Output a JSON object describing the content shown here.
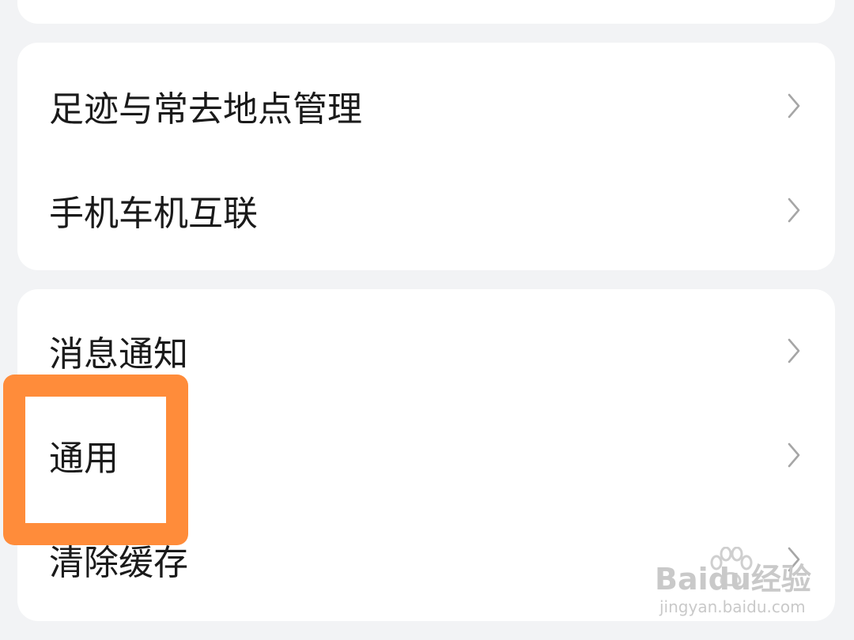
{
  "settings_groups": [
    {
      "items": [
        {
          "label": "足迹与常去地点管理"
        },
        {
          "label": "手机车机互联"
        }
      ]
    },
    {
      "items": [
        {
          "label": "消息通知"
        },
        {
          "label": "通用"
        },
        {
          "label": "清除缓存"
        }
      ]
    }
  ],
  "highlight": {
    "target": "通用",
    "color": "#ff8c3a"
  },
  "watermark": {
    "brand": "Baidu经验",
    "url": "jingyan.baidu.com"
  },
  "icons": {
    "row_chevron": "chevron-right-icon",
    "watermark_logo": "baidu-paw-icon"
  }
}
